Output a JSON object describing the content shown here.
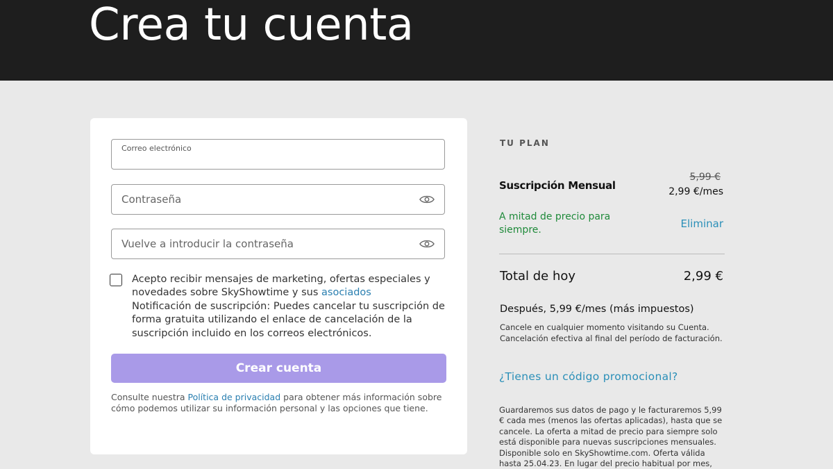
{
  "header": {
    "title": "Crea tu cuenta"
  },
  "form": {
    "email_label": "Correo electrónico",
    "email_value": "",
    "password_placeholder": "Contraseña",
    "password_value": "",
    "confirm_placeholder": "Vuelve a introducir la contraseña",
    "confirm_value": "",
    "eye_icon": "eye-icon",
    "consent_text_before": "Acepto recibir mensajes de marketing, ofertas especiales y novedades sobre SkyShowtime y sus ",
    "consent_link": "asociados",
    "consent_text_after": "Notificación de suscripción: Puedes cancelar tu suscripción de forma gratuita utilizando el enlace de cancelación de la suscripción incluido en los correos electrónicos.",
    "consent_checked": false,
    "submit_label": "Crear cuenta",
    "privacy_before": "Consulte nuestra ",
    "privacy_link": "Política de privacidad",
    "privacy_after": " para obtener más información sobre cómo podemos utilizar su información personal y las opciones que tiene."
  },
  "plan": {
    "heading": "TU PLAN",
    "name": "Suscripción Mensual",
    "original_price": "5,99 €",
    "discounted_price": "2,99 €/mes",
    "promo_note": "A mitad de precio para siempre.",
    "remove_label": "Eliminar",
    "total_label": "Total de hoy",
    "total_value": "2,99 €",
    "after_price": "Después, 5,99 €/mes (más impuestos)",
    "cancel_note": "Cancele en cualquier momento visitando su Cuenta. Cancelación efectiva al final del período de facturación.",
    "promo_code_link": "¿Tienes un código promocional?",
    "legal_text": "Guardaremos sus datos de pago y le facturaremos 5,99 € cada mes (menos las ofertas aplicadas), hasta que se cancele. La oferta a mitad de precio para siempre solo está disponible para nuevas suscripciones mensuales. Disponible solo en SkyShowtime.com. Oferta válida hasta 25.04.23. En lugar del precio habitual por mes,"
  },
  "colors": {
    "header_bg": "#1e1e1e",
    "page_bg": "#e9e9e9",
    "button_bg": "#a99ae8",
    "link": "#2a7fb0",
    "promo_green": "#1f8a3a"
  }
}
